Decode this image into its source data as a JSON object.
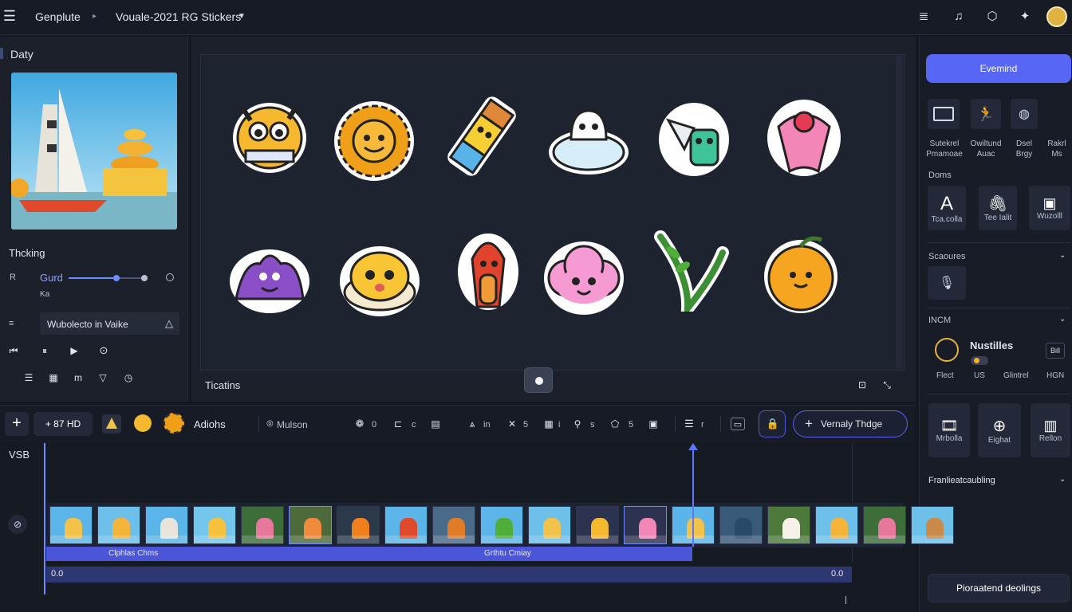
{
  "header": {
    "app_name": "Genplute",
    "project_title": "Vouale-2021 RG Stickers"
  },
  "left_panel": {
    "section_title": "Daty",
    "tracking_label": "Thcking",
    "slider_label": "Gurd",
    "slider_sub": "Ka",
    "slider_value": 0.62,
    "input_text": "Wubolecto in Vaike"
  },
  "canvas": {
    "bottom_label": "Ticatins",
    "stickers_row1": [
      "yellow-monster",
      "sun-face",
      "pencil-character",
      "cloud-face",
      "bird-character",
      "pink-flower"
    ],
    "stickers_row2": [
      "purple-blob",
      "egg-face",
      "red-bird",
      "pink-cloud",
      "green-sprout",
      "orange-fruit"
    ]
  },
  "right_panel": {
    "primary_button": "Evemind",
    "tools_row1": [
      {
        "label": "Sutekrel Pmamoae",
        "icon": "layout-icon"
      },
      {
        "label": "Owiltund Auac",
        "icon": "figure-icon"
      },
      {
        "label": "Dsel Brgy",
        "icon": "sphere-icon"
      },
      {
        "label": "Rakrl Ms",
        "icon": "more-icon"
      }
    ],
    "section_doms": "Doms",
    "tools_row2": [
      {
        "label": "Tca.colla",
        "icon": "text-icon"
      },
      {
        "label": "Tee Ialit",
        "icon": "clip-icon"
      },
      {
        "label": "Wuzolll",
        "icon": "image-icon"
      }
    ],
    "section_scaours": "Scaoures",
    "section_incm": "INCM",
    "nustilles": {
      "title": "Nustilles",
      "badge": "Bill",
      "labels": [
        "Flect",
        "US",
        "Glintrel",
        "HGN"
      ]
    },
    "tools_row3": [
      {
        "label": "Mrbolla",
        "icon": "film-icon"
      },
      {
        "label": "Eighat",
        "icon": "globe-icon"
      },
      {
        "label": "Rellon",
        "icon": "bars-icon"
      }
    ],
    "section_framing": "Franlieatcaubling",
    "bottom_button": "Pioraatend deolings"
  },
  "timeline_toolbar": {
    "add_label": "+ 87 HD",
    "actions_label": "Adiohs",
    "mode_label": "Mulson",
    "counts": [
      "0",
      "c",
      "in",
      "5",
      "i",
      "s",
      "5",
      "r"
    ],
    "velocity_button": "Vernaly Thdge"
  },
  "timeline": {
    "track_label": "VSB",
    "clip_label_1": "Clphlas Chms",
    "clip_label_2": "Grthtu Cmiay",
    "time_start": "0.0",
    "time_end": "0.0",
    "playhead_fraction": 0.75
  }
}
